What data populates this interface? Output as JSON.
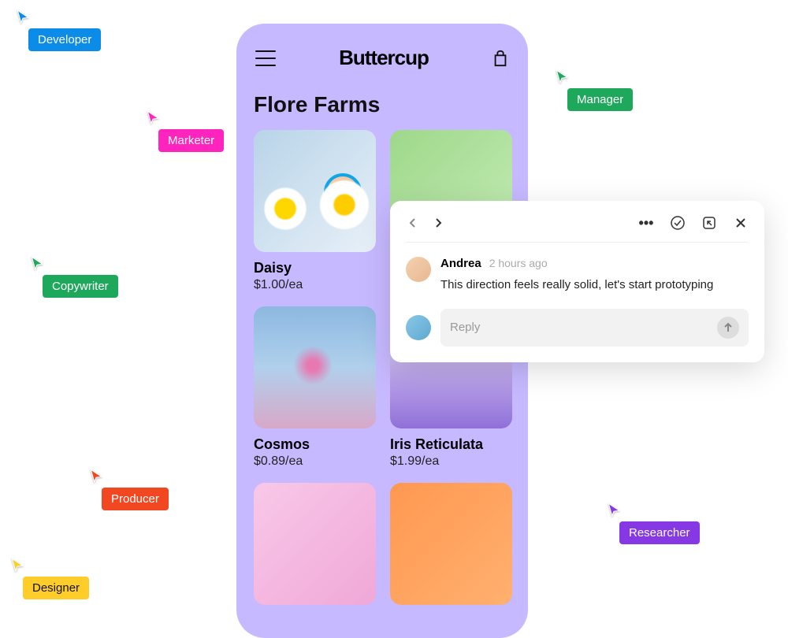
{
  "cursors": {
    "developer": {
      "label": "Developer",
      "color": "#0C8CE9"
    },
    "marketer": {
      "label": "Marketer",
      "color": "#FF24BD"
    },
    "copywriter": {
      "label": "Copywriter",
      "color": "#1EA85B"
    },
    "manager": {
      "label": "Manager",
      "color": "#1EA85B"
    },
    "producer": {
      "label": "Producer",
      "color": "#F24822"
    },
    "researcher": {
      "label": "Researcher",
      "color": "#8638E5"
    },
    "designer": {
      "label": "Designer",
      "color": "#FFCD29"
    }
  },
  "phone": {
    "brand": "Buttercup",
    "section_title": "Flore Farms",
    "products": [
      {
        "name": "Daisy",
        "price": "$1.00/ea"
      },
      {
        "name": "",
        "price": ""
      },
      {
        "name": "Cosmos",
        "price": "$0.89/ea"
      },
      {
        "name": "Iris Reticulata",
        "price": "$1.99/ea"
      }
    ]
  },
  "comment": {
    "author": "Andrea",
    "time": "2 hours ago",
    "text": "This direction feels really solid, let's start prototyping",
    "reply_placeholder": "Reply"
  }
}
